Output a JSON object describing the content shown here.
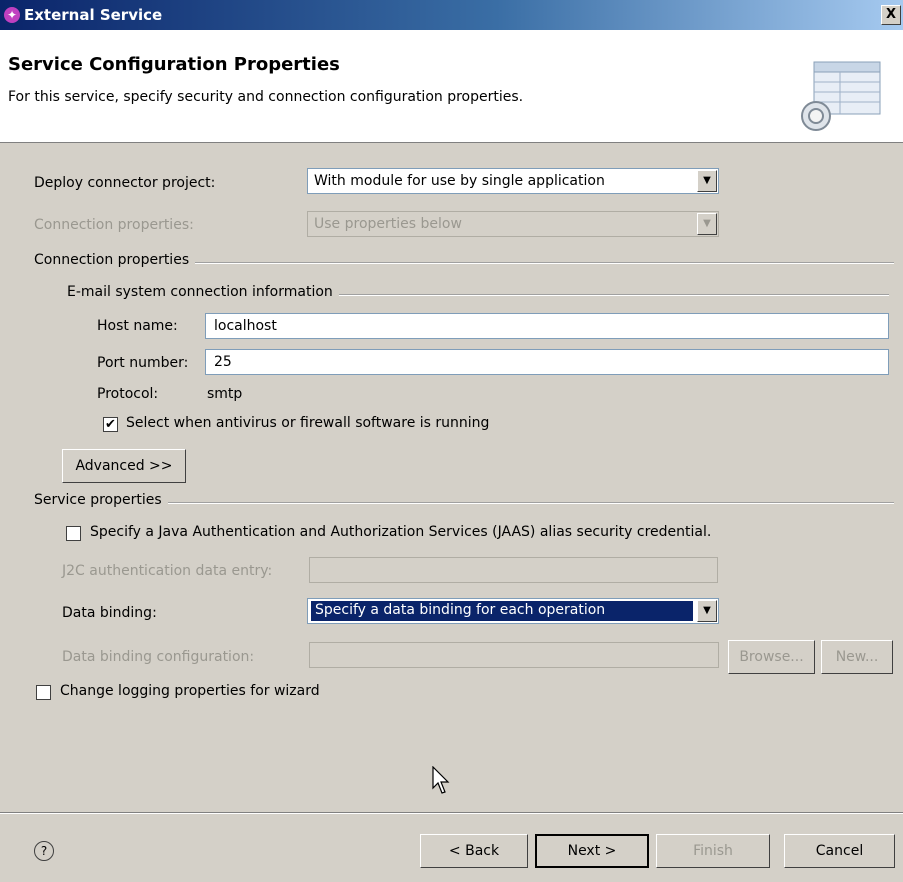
{
  "window": {
    "title": "External Service",
    "close_glyph": "X"
  },
  "header": {
    "title": "Service Configuration Properties",
    "description": "For this service, specify security and connection configuration properties.",
    "banner_icon": "configuration-wizard-icon"
  },
  "deploy": {
    "label": "Deploy connector project:",
    "value": "With module for use by single application"
  },
  "connection_props_select": {
    "label": "Connection properties:",
    "value": "Use properties below"
  },
  "connection_group": {
    "label": "Connection properties"
  },
  "email_group": {
    "label": "E-mail system connection information"
  },
  "host": {
    "label": "Host name:",
    "value": "localhost"
  },
  "port": {
    "label": "Port number:",
    "value": "25"
  },
  "protocol": {
    "label": "Protocol:",
    "value": "smtp"
  },
  "antivirus": {
    "label": "Select when antivirus or firewall software is running",
    "checked": true
  },
  "advanced_button": {
    "label": "Advanced >>"
  },
  "service_group": {
    "label": "Service properties"
  },
  "jaas": {
    "label": "Specify a Java Authentication and Authorization Services (JAAS) alias security credential.",
    "checked": false
  },
  "j2c": {
    "label": "J2C authentication data entry:",
    "value": ""
  },
  "data_binding": {
    "label": "Data binding:",
    "value": "Specify a data binding for each operation"
  },
  "data_binding_config": {
    "label": "Data binding configuration:",
    "value": ""
  },
  "browse_button": {
    "label": "Browse..."
  },
  "new_button": {
    "label": "New..."
  },
  "logging": {
    "label": "Change logging properties for wizard",
    "checked": false
  },
  "footer": {
    "help_glyph": "?",
    "back": "< Back",
    "next": "Next >",
    "finish": "Finish",
    "cancel": "Cancel"
  },
  "colors": {
    "title_bar_start": "#0a246a",
    "title_bar_end": "#a6caf0",
    "dialog_bg": "#d4d0c8",
    "selection": "#0a246a",
    "disabled_text": "#9a9890"
  }
}
